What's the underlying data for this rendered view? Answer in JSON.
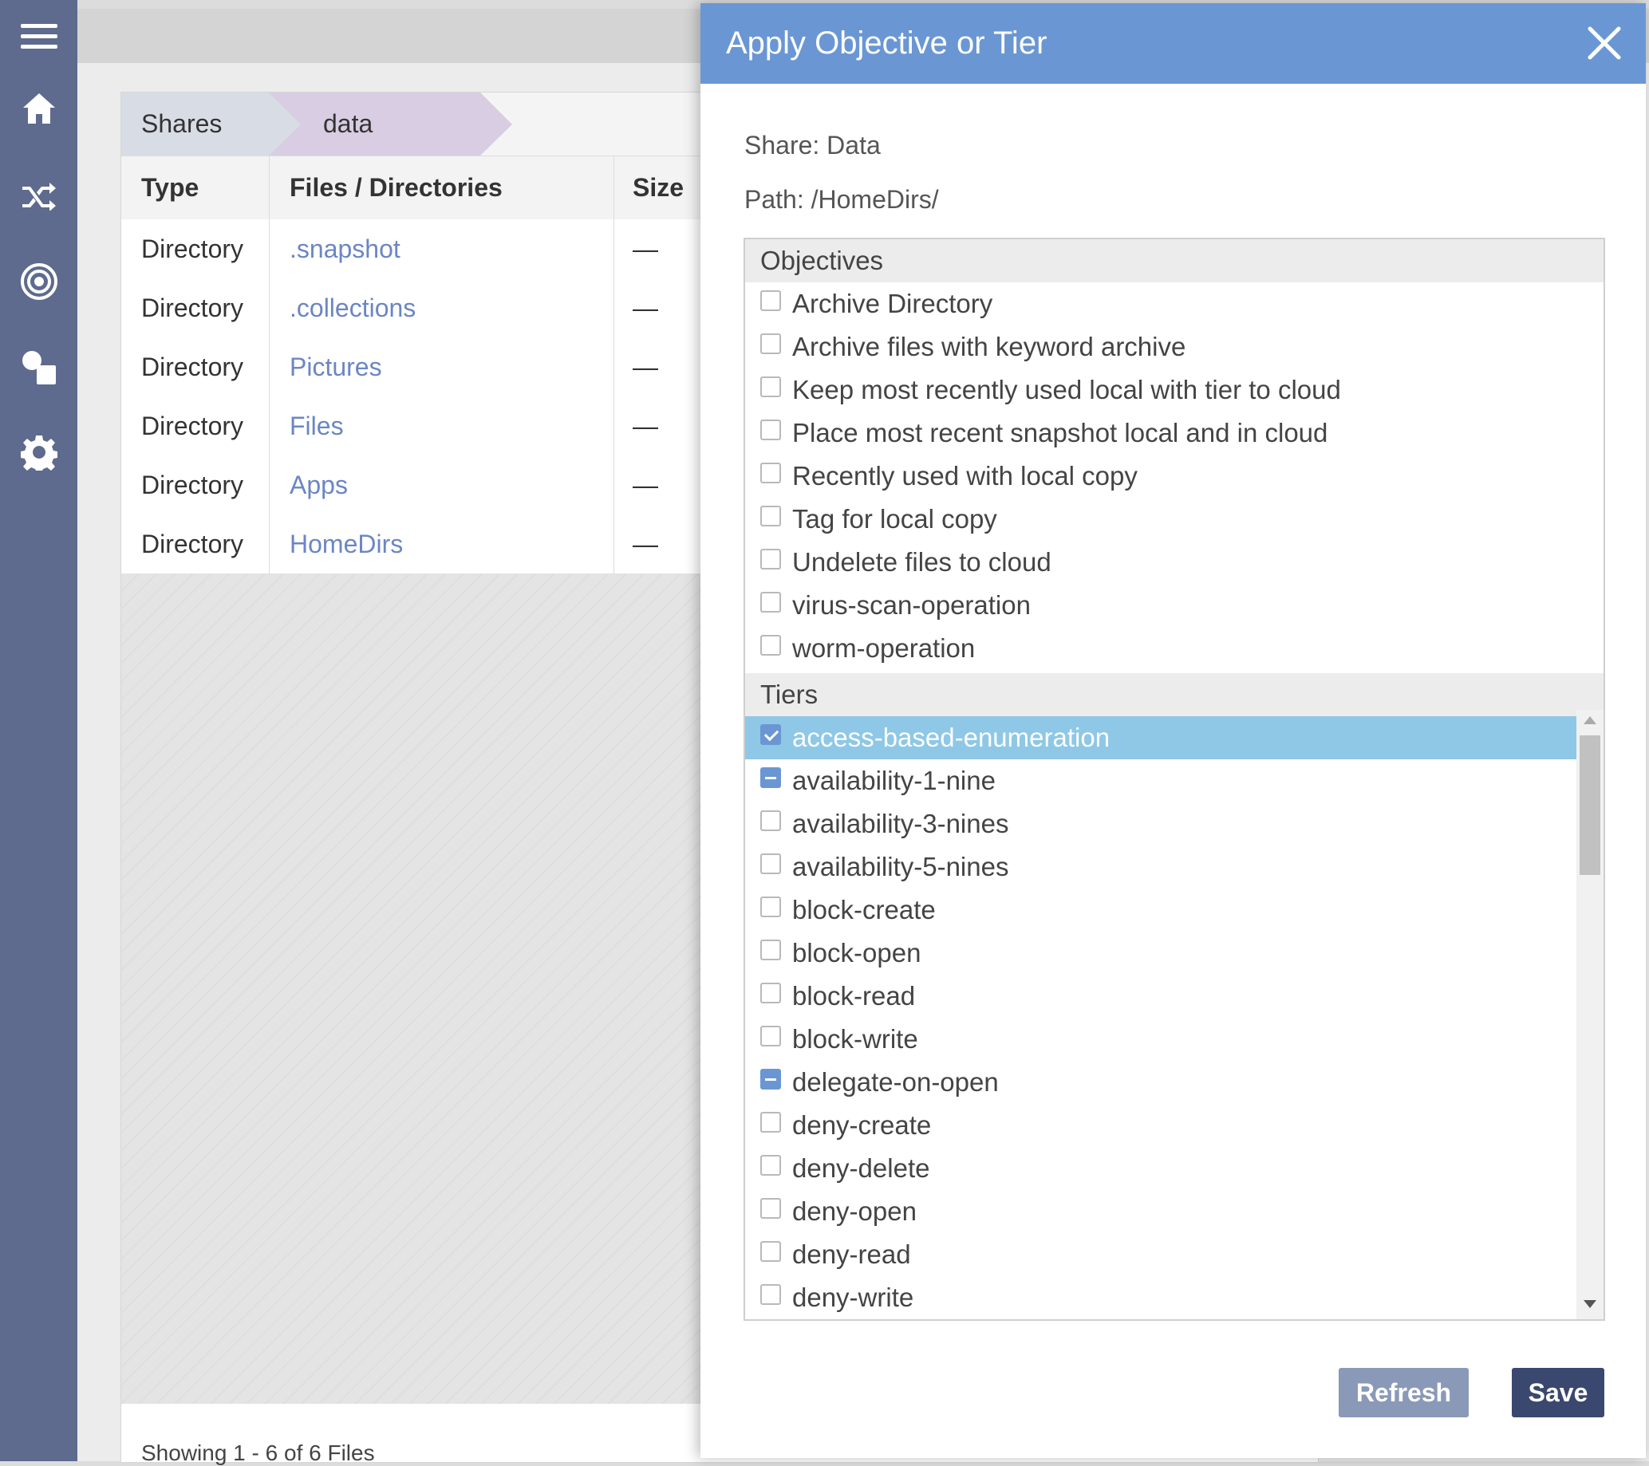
{
  "nav": {
    "items": [
      "menu-icon",
      "home-icon",
      "shuffle-icon",
      "target-icon",
      "shapes-icon",
      "gear-icon"
    ],
    "background": "#5e6a8e"
  },
  "breadcrumb": [
    "Shares",
    "data"
  ],
  "table": {
    "headers": [
      "Type",
      "Files / Directories",
      "Size"
    ],
    "rows": [
      {
        "type": "Directory",
        "name": ".snapshot",
        "size": "—"
      },
      {
        "type": "Directory",
        "name": ".collections",
        "size": "—"
      },
      {
        "type": "Directory",
        "name": "Pictures",
        "size": "—"
      },
      {
        "type": "Directory",
        "name": "Files",
        "size": "—"
      },
      {
        "type": "Directory",
        "name": "Apps",
        "size": "—"
      },
      {
        "type": "Directory",
        "name": "HomeDirs",
        "size": "—"
      }
    ],
    "footer": "Showing 1 - 6 of 6 Files"
  },
  "modal": {
    "title": "Apply Objective or Tier",
    "share": "Share: Data",
    "path": "Path: /HomeDirs/",
    "objectives_label": "Objectives",
    "objectives": [
      {
        "label": "Archive Directory",
        "state": "unchecked"
      },
      {
        "label": "Archive files with keyword archive",
        "state": "unchecked"
      },
      {
        "label": "Keep most recently used local with tier to cloud",
        "state": "unchecked"
      },
      {
        "label": "Place most recent snapshot local and in cloud",
        "state": "unchecked"
      },
      {
        "label": "Recently used with local copy",
        "state": "unchecked"
      },
      {
        "label": "Tag for local copy",
        "state": "unchecked"
      },
      {
        "label": "Undelete files to cloud",
        "state": "unchecked"
      },
      {
        "label": "virus-scan-operation",
        "state": "unchecked"
      },
      {
        "label": "worm-operation",
        "state": "unchecked"
      }
    ],
    "tiers_label": "Tiers",
    "tiers": [
      {
        "label": "access-based-enumeration",
        "state": "checked",
        "selected": true
      },
      {
        "label": "availability-1-nine",
        "state": "partial"
      },
      {
        "label": "availability-3-nines",
        "state": "unchecked"
      },
      {
        "label": "availability-5-nines",
        "state": "unchecked"
      },
      {
        "label": "block-create",
        "state": "unchecked"
      },
      {
        "label": "block-open",
        "state": "unchecked"
      },
      {
        "label": "block-read",
        "state": "unchecked"
      },
      {
        "label": "block-write",
        "state": "unchecked"
      },
      {
        "label": "delegate-on-open",
        "state": "partial"
      },
      {
        "label": "deny-create",
        "state": "unchecked"
      },
      {
        "label": "deny-delete",
        "state": "unchecked"
      },
      {
        "label": "deny-open",
        "state": "unchecked"
      },
      {
        "label": "deny-read",
        "state": "unchecked"
      },
      {
        "label": "deny-write",
        "state": "unchecked"
      }
    ],
    "refresh_label": "Refresh",
    "save_label": "Save",
    "header_color": "#6a97d3",
    "selected_color": "#8ec8e6"
  }
}
